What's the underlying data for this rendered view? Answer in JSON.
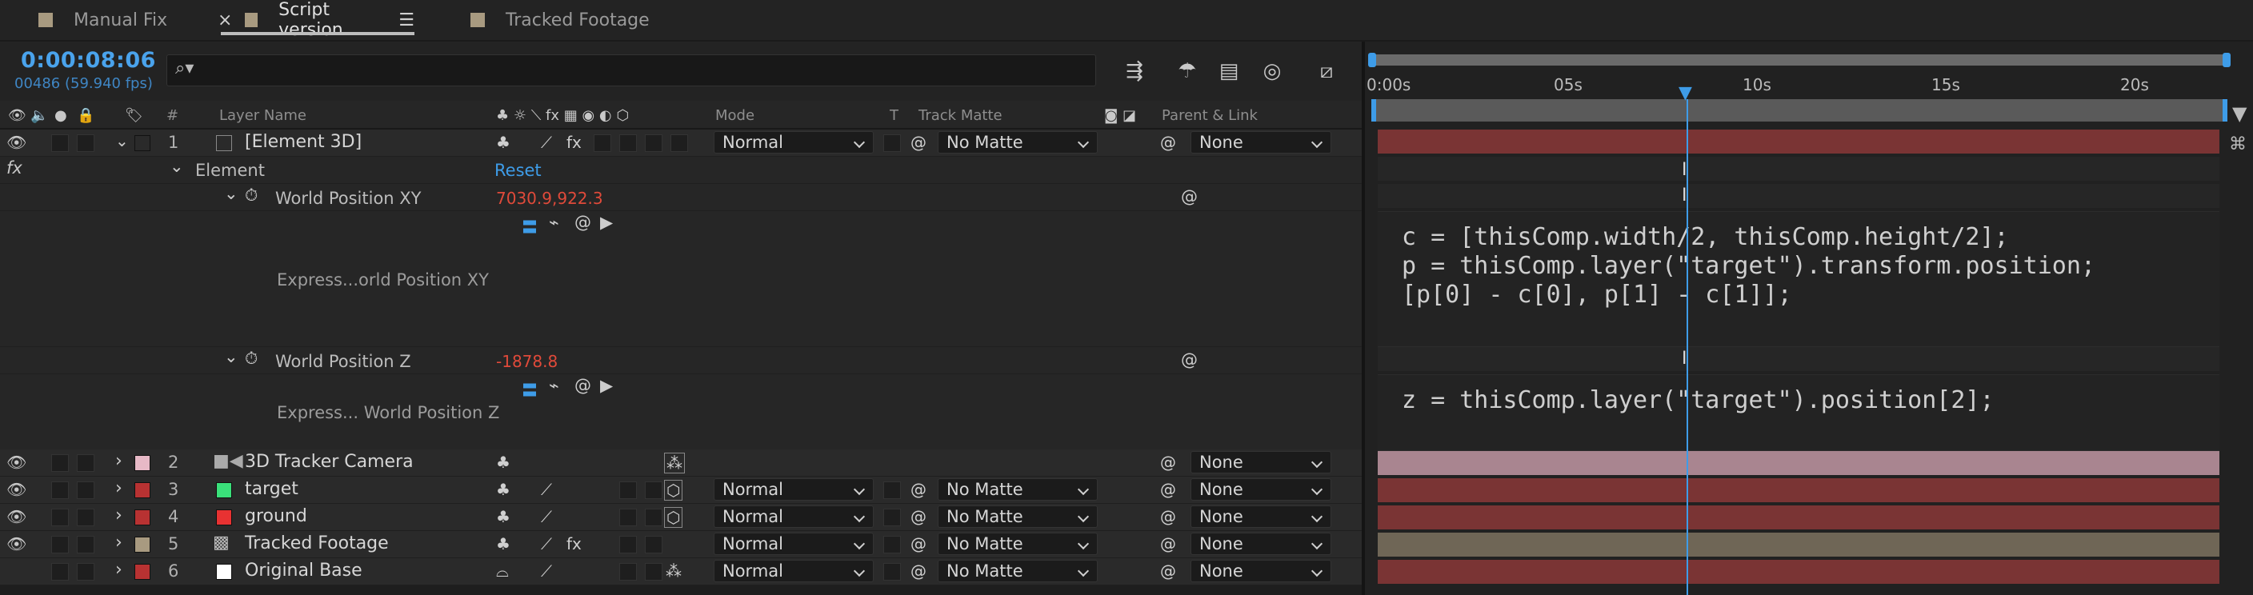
{
  "tabs": [
    {
      "label": "Manual Fix",
      "color": "#a89a80"
    },
    {
      "label": "Script version",
      "color": "#a89a80"
    },
    {
      "label": "Tracked Footage",
      "color": "#a89a80"
    }
  ],
  "header": {
    "timecode": "0:00:08:06",
    "frames": "00486 (59.940 fps)",
    "search_placeholder": ""
  },
  "columns": {
    "num": "#",
    "layer_name": "Layer Name",
    "mode": "Mode",
    "t": "T",
    "track_matte": "Track Matte",
    "parent": "Parent & Link"
  },
  "ruler": {
    "ticks": [
      "0:00s",
      "05s",
      "10s",
      "15s",
      "20s"
    ]
  },
  "layers": [
    {
      "num": "1",
      "name": "[Element 3D]",
      "label_color": "#b83232",
      "icon_color": "#6a6a6a",
      "mode": "Normal",
      "matte": "No Matte",
      "parent": "None",
      "bar_color": "#7a3434"
    },
    {
      "num": "2",
      "name": "3D Tracker Camera",
      "label_color": "#e7b9c6",
      "icon_color": "",
      "mode": "",
      "matte": "",
      "parent": "None",
      "bar_color": "#a98590"
    },
    {
      "num": "3",
      "name": "target",
      "label_color": "#b83232",
      "icon_color": "#3ae07a",
      "mode": "Normal",
      "matte": "No Matte",
      "parent": "None",
      "bar_color": "#7a3434"
    },
    {
      "num": "4",
      "name": "ground",
      "label_color": "#b83232",
      "icon_color": "#e83232",
      "mode": "Normal",
      "matte": "No Matte",
      "parent": "None",
      "bar_color": "#7a3434"
    },
    {
      "num": "5",
      "name": "Tracked Footage",
      "label_color": "#a89a80",
      "icon_color": "",
      "mode": "Normal",
      "matte": "No Matte",
      "parent": "None",
      "bar_color": "#6f6656"
    },
    {
      "num": "6",
      "name": "Original Base",
      "label_color": "#b83232",
      "icon_color": "#ffffff",
      "mode": "Normal",
      "matte": "No Matte",
      "parent": "None",
      "bar_color": "#7a3434"
    }
  ],
  "element_group": {
    "label": "Element",
    "reset": "Reset"
  },
  "props": [
    {
      "name": "World Position XY",
      "value": "7030.9,922.3",
      "expr_label": "Express...orld Position XY"
    },
    {
      "name": "World Position Z",
      "value": "-1878.8",
      "expr_label": "Express... World Position Z"
    }
  ],
  "expressions": {
    "xy": [
      "c = [thisComp.width/2, thisComp.height/2];",
      "p = thisComp.layer(\"target\").transform.position;",
      "[p[0] - c[0], p[1] - c[1]];"
    ],
    "z": [
      "z = thisComp.layer(\"target\").position[2];"
    ]
  },
  "colors": {
    "accent": "#3e9ce8",
    "value_red": "#e04a3a"
  }
}
